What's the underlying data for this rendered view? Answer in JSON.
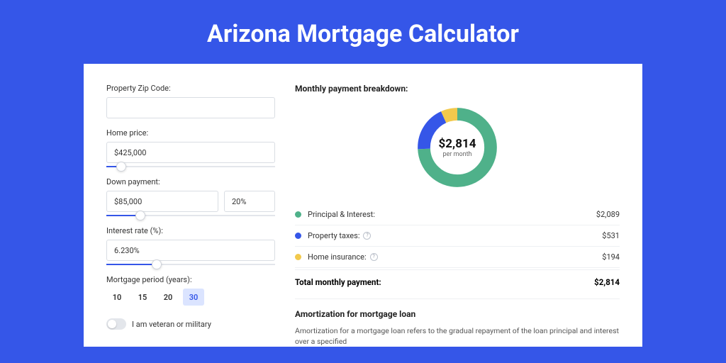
{
  "title": "Arizona Mortgage Calculator",
  "form": {
    "zip": {
      "label": "Property Zip Code:",
      "value": ""
    },
    "home_price": {
      "label": "Home price:",
      "value": "$425,000",
      "slider_pct": 9
    },
    "down_payment": {
      "label": "Down payment:",
      "value": "$85,000",
      "pct_value": "20%",
      "slider_pct": 20
    },
    "interest": {
      "label": "Interest rate (%):",
      "value": "6.230%",
      "slider_pct": 30
    },
    "period": {
      "label": "Mortgage period (years):",
      "options": [
        "10",
        "15",
        "20",
        "30"
      ],
      "active": "30"
    },
    "veteran": {
      "label": "I am veteran or military",
      "on": false
    }
  },
  "breakdown": {
    "title": "Monthly payment breakdown:",
    "center_value": "$2,814",
    "center_sub": "per month",
    "items": [
      {
        "label": "Principal & Interest:",
        "value": "$2,089",
        "color": "#4fb18a",
        "info": false
      },
      {
        "label": "Property taxes:",
        "value": "$531",
        "color": "#3556e8",
        "info": true
      },
      {
        "label": "Home insurance:",
        "value": "$194",
        "color": "#f2c94c",
        "info": true
      }
    ],
    "total_label": "Total monthly payment:",
    "total_value": "$2,814"
  },
  "amort": {
    "title": "Amortization for mortgage loan",
    "body": "Amortization for a mortgage loan refers to the gradual repayment of the loan principal and interest over a specified"
  },
  "chart_data": {
    "type": "pie",
    "title": "Monthly payment breakdown",
    "series": [
      {
        "name": "Principal & Interest",
        "value": 2089,
        "color": "#4fb18a"
      },
      {
        "name": "Property taxes",
        "value": 531,
        "color": "#3556e8"
      },
      {
        "name": "Home insurance",
        "value": 194,
        "color": "#f2c94c"
      }
    ],
    "total": 2814,
    "center_label": "$2,814 per month"
  }
}
